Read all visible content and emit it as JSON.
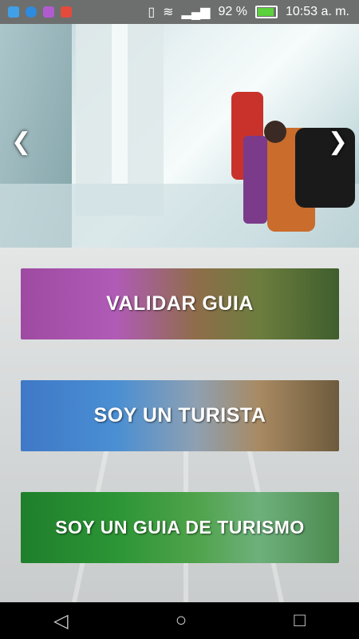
{
  "status_bar": {
    "battery": "92 %",
    "time": "10:53 a. m."
  },
  "hero": {
    "prev_glyph": "❮",
    "next_glyph": "❯"
  },
  "buttons": [
    {
      "label": "VALIDAR GUIA"
    },
    {
      "label": "SOY UN TURISTA"
    },
    {
      "label": "SOY UN GUIA DE TURISMO"
    }
  ],
  "nav": {
    "back": "◁",
    "home": "○",
    "recents": "□"
  },
  "colors": {
    "status_bar": "#6d6f6f",
    "nav_bar": "#000000",
    "validar_accent": "#9e4aa2",
    "turista_accent": "#3f78c7",
    "guia_accent": "#1f7f2c"
  }
}
